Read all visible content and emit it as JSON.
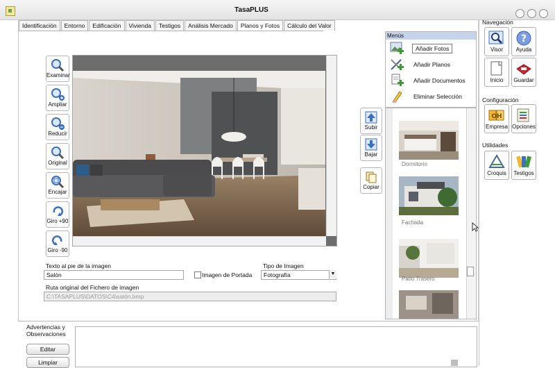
{
  "window": {
    "title": "TasaPLUS"
  },
  "tabs": [
    {
      "label": "Identificación"
    },
    {
      "label": "Entorno"
    },
    {
      "label": "Edificación"
    },
    {
      "label": "Vivienda"
    },
    {
      "label": "Testigos"
    },
    {
      "label": "Análisis Mercado"
    },
    {
      "label": "Planos y Fotos",
      "active": true
    },
    {
      "label": "Cálculo del Valor"
    }
  ],
  "tools": [
    {
      "label": "Examinar",
      "icon": "magnifier-icon"
    },
    {
      "label": "Ampliar",
      "icon": "zoom-in-icon"
    },
    {
      "label": "Reducir",
      "icon": "zoom-out-icon"
    },
    {
      "label": "Original",
      "icon": "zoom-original-icon"
    },
    {
      "label": "Encajar",
      "icon": "zoom-fit-icon"
    },
    {
      "label": "Giro +90",
      "icon": "rotate-cw-icon"
    },
    {
      "label": "Giro -90",
      "icon": "rotate-ccw-icon"
    }
  ],
  "move_buttons": [
    {
      "label": "Subir",
      "icon": "move-up-icon"
    },
    {
      "label": "Bajar",
      "icon": "move-down-icon"
    },
    {
      "label": "Copiar",
      "icon": "copy-icon"
    }
  ],
  "menus": {
    "title": "Menús",
    "items": [
      {
        "label": "Añadir Fotos",
        "icon": "add-photos-icon",
        "selected": true
      },
      {
        "label": "Añadir Planos",
        "icon": "add-plans-icon"
      },
      {
        "label": "Añadir Documentos",
        "icon": "add-documents-icon"
      },
      {
        "label": "Eliminar Selección",
        "icon": "delete-selection-icon"
      }
    ]
  },
  "thumbnails": [
    {
      "caption": "Dormitorio"
    },
    {
      "caption": "Fachada"
    },
    {
      "caption": "Patio Trasero"
    }
  ],
  "form": {
    "caption_label": "Texto al pie de la imagen",
    "caption_value": "Salón",
    "cover_label": "Imagen de Portada",
    "cover_checked": false,
    "type_label": "Tipo de Imagen",
    "type_value": "Fotografía",
    "path_label": "Ruta original del Fichero de imagen",
    "path_value": "C:\\TASAPLUS\\DATOS\\C4\\salón.bmp"
  },
  "observations": {
    "label_line1": "Advertencias y",
    "label_line2": "Observaciones",
    "edit_label": "Editar",
    "clear_label": "Limpiar"
  },
  "nav": {
    "section_navegacion": "Navegación",
    "section_configuracion": "Configuración",
    "section_utilidades": "Utilidades",
    "buttons": [
      {
        "label": "Visor",
        "icon": "viewer-icon"
      },
      {
        "label": "Ayuda",
        "icon": "help-icon"
      },
      {
        "label": "Inicio",
        "icon": "home-document-icon"
      },
      {
        "label": "Guardar",
        "icon": "save-icon"
      },
      {
        "label": "Empresa",
        "icon": "company-icon"
      },
      {
        "label": "Opciones",
        "icon": "options-icon"
      },
      {
        "label": "Croquis",
        "icon": "sketch-icon"
      },
      {
        "label": "Testigos",
        "icon": "witnesses-icon"
      }
    ]
  },
  "colors": {
    "menus_header": "#c5d4e8",
    "viewer_background": "#6d6d6d",
    "accent_blue": "#3a6fc4",
    "accent_red": "#d0242a",
    "accent_green": "#3f9a3c"
  }
}
